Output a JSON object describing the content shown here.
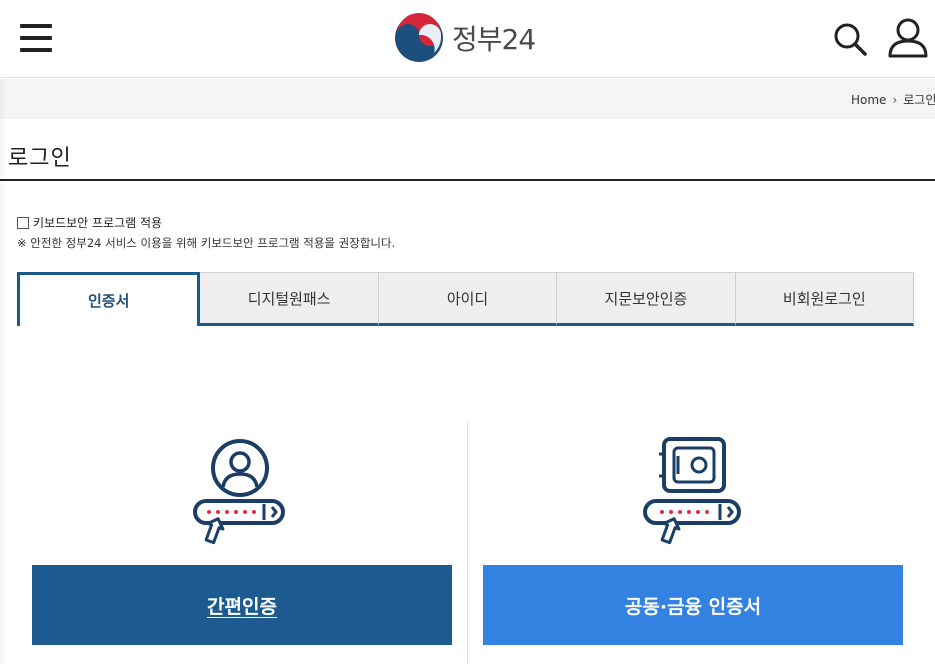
{
  "header": {
    "logo_text": "정부24"
  },
  "breadcrumb": {
    "home": "Home",
    "current": "로그인"
  },
  "page": {
    "title": "로그인"
  },
  "security": {
    "keyboard_label": "키보드보안 프로그램 적용",
    "notice": "※ 안전한 정부24 서비스 이용을 위해 키보드보안 프로그램 적용을 권장합니다.",
    "checked": false
  },
  "tabs": [
    {
      "label": "인증서",
      "active": true
    },
    {
      "label": "디지털원패스",
      "active": false
    },
    {
      "label": "아이디",
      "active": false
    },
    {
      "label": "지문보안인증",
      "active": false
    },
    {
      "label": "비회원로그인",
      "active": false
    }
  ],
  "auth": {
    "simple_label": "간편인증",
    "joint_label": "공동·금융 인증서"
  },
  "colors": {
    "primary_dark": "#1d5a8f",
    "primary_light": "#3381e0",
    "logo_red": "#d6263a",
    "logo_blue": "#1d4f7c"
  },
  "icons": {
    "menu": "hamburger-icon",
    "search": "search-icon",
    "user": "user-icon",
    "simple_auth": "person-id-card-icon",
    "joint_auth": "safe-card-icon"
  }
}
